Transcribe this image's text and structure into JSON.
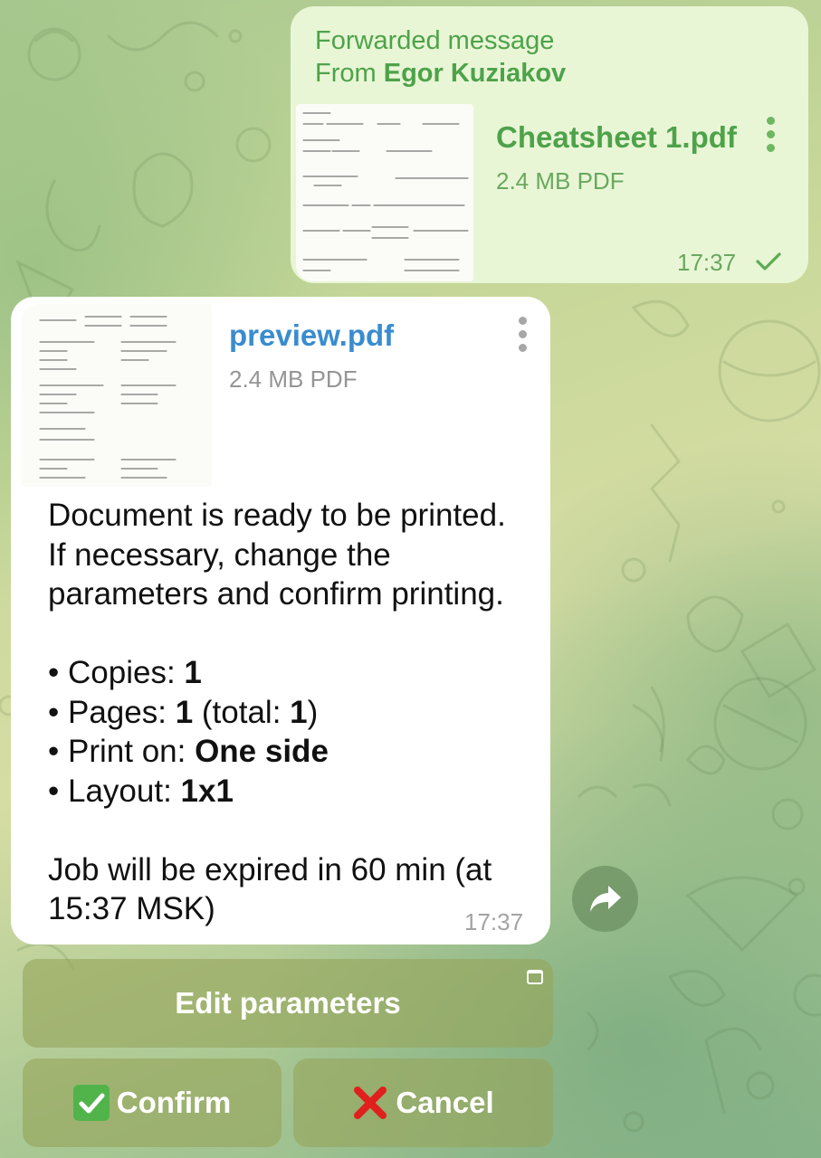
{
  "forwarded": {
    "header_prefix": "Forwarded message",
    "from_prefix": "From",
    "from_name": "Egor Kuziakov",
    "file_name": "Cheatsheet 1.pdf",
    "file_size": "2.4 MB PDF",
    "time": "17:37",
    "status_icon": "check-icon"
  },
  "bot_message": {
    "file_name": "preview.pdf",
    "file_size": "2.4 MB PDF",
    "lines": [
      "Document is ready to be printed.",
      "If necessary, change the",
      "parameters and confirm printing."
    ],
    "items": [
      {
        "bullet": "•",
        "label": "Copies: ",
        "value": "1",
        "suffix": ""
      },
      {
        "bullet": "•",
        "label": "Pages: ",
        "value": "1",
        "suffix": " (total: ",
        "value2": "1",
        "suffix2": ")"
      },
      {
        "bullet": "•",
        "label": "Print on: ",
        "value": "One side",
        "suffix": ""
      },
      {
        "bullet": "•",
        "label": "Layout: ",
        "value": "1x1",
        "suffix": ""
      }
    ],
    "expiry_line1": "Job will be expired in 60 min (at",
    "expiry_line2": "15:37 MSK)",
    "time": "17:37"
  },
  "keyboard": {
    "edit_label": "Edit parameters",
    "confirm_label": "Confirm",
    "cancel_label": "Cancel",
    "confirm_emoji": "✅",
    "cancel_emoji": "❌"
  },
  "colors": {
    "outgoing_bubble": "#e8f6d6",
    "outgoing_accent": "#4ea24a",
    "incoming_bubble": "#ffffff",
    "link_blue": "#3a8ccf",
    "keyboard_button": "#96a55a"
  }
}
